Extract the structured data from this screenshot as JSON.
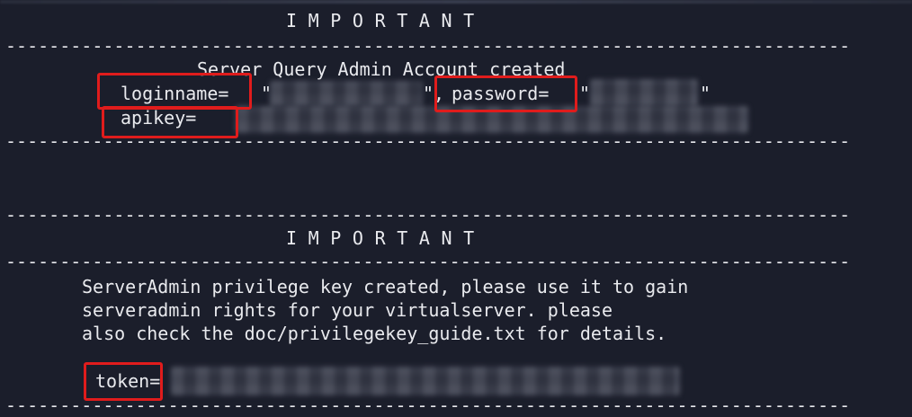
{
  "terminal": {
    "separator": "------------------------------------------------------------------------------",
    "block1": {
      "header": "IMPORTANT",
      "line_created": "Server Query Admin Account created",
      "loginname_label": "loginname=",
      "quote_open": "\"",
      "quote_comma": "\",",
      "password_label": "password=",
      "quote_close": "\"",
      "apikey_label": "apikey="
    },
    "block2": {
      "header": "IMPORTANT",
      "message_line1": "ServerAdmin privilege key created, please use it to gain",
      "message_line2": "serveradmin rights for your virtualserver. please",
      "message_line3": "also check the doc/privilegekey_guide.txt for details.",
      "token_label": "token="
    },
    "highlight_color": "#e01c1c",
    "background_color": "#1b1e2b"
  }
}
